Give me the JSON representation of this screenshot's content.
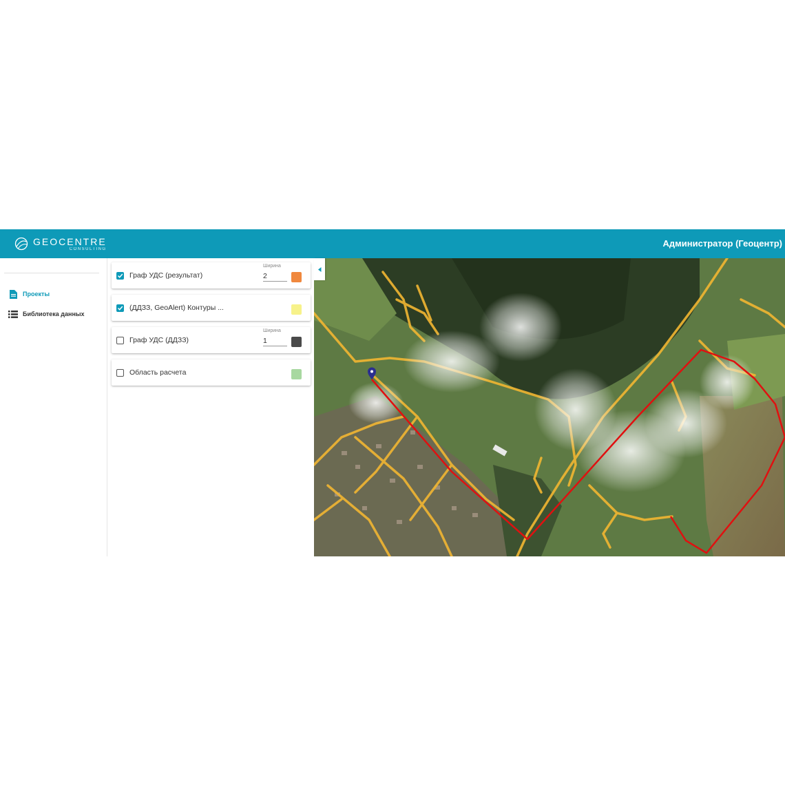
{
  "header": {
    "logo_name": "GEOCENTRE",
    "logo_sub": "CONSULTING",
    "user": "Администратор (Геоцентр)"
  },
  "nav": {
    "items": [
      {
        "label": "Проекты",
        "icon": "document-icon",
        "active": true
      },
      {
        "label": "Библиотека данных",
        "icon": "list-icon",
        "active": false
      }
    ]
  },
  "layers": [
    {
      "name": "Граф УДС (результат)",
      "checked": true,
      "width_label": "Ширина",
      "width": "2",
      "color": "#f0883e"
    },
    {
      "name": "(ДДЗЗ, GeoAlert) Контуры ...",
      "checked": true,
      "width_label": "",
      "width": "",
      "color": "#f7f28a"
    },
    {
      "name": "Граф УДС (ДДЗЗ)",
      "checked": false,
      "width_label": "Ширина",
      "width": "1",
      "color": "#4a4a4a"
    },
    {
      "name": "Область расчета",
      "checked": false,
      "width_label": "",
      "width": "",
      "color": "#a8d8a0"
    }
  ],
  "colors": {
    "accent": "#0e9ab8",
    "route": "#e01010",
    "road": "#f2b632"
  },
  "map": {
    "marker_icon": "map-pin-icon",
    "collapse_icon": "chevron-left-icon"
  }
}
